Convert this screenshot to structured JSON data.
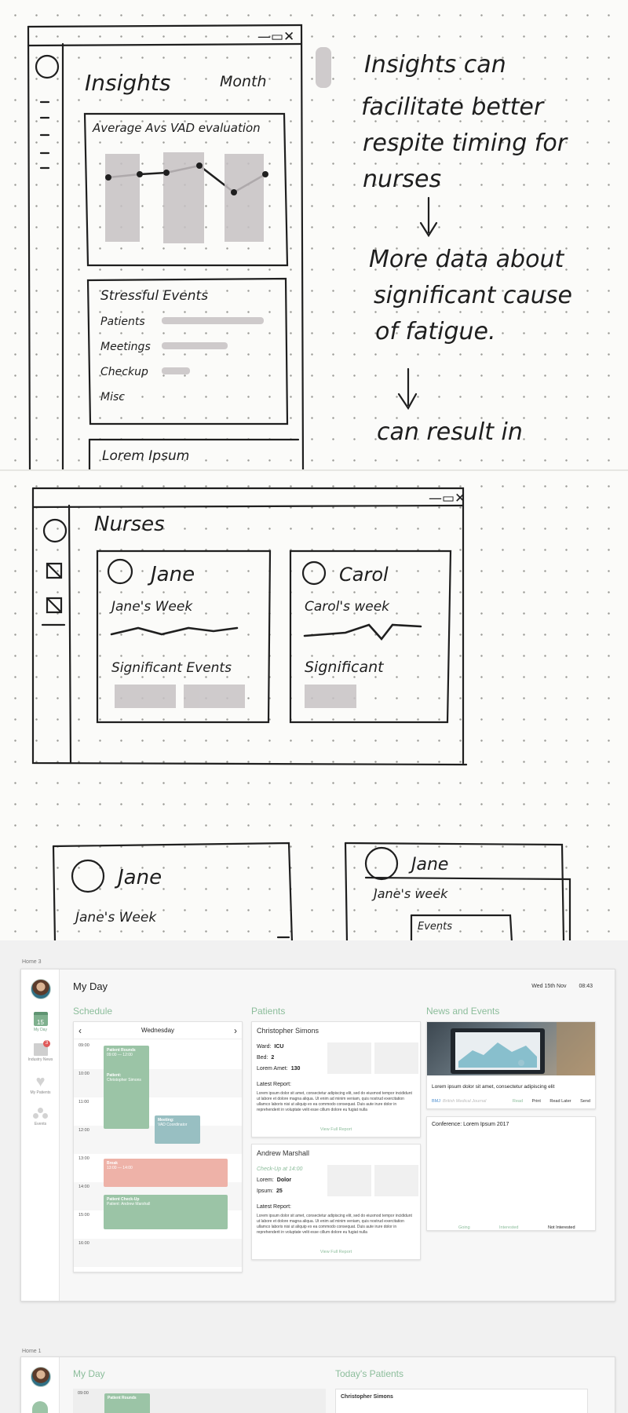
{
  "sketch1": {
    "window_controls": "—▭✕",
    "title": "Insights",
    "period_select": "Month",
    "chart_title": "Average Avs VAD evaluation",
    "events_title": "Stressful Events",
    "event_rows": [
      "Patients",
      "Meetings",
      "Checkup",
      "Misc"
    ],
    "bottom_card": "Lorem Ipsum",
    "note_lines": [
      "Insights can",
      "facilitate better",
      "respite timing for",
      "nurses",
      "↓",
      "More data about",
      "significant cause",
      "of fatigue.",
      "↓",
      "can result in"
    ]
  },
  "sketch2": {
    "title": "Nurses",
    "cards": [
      {
        "name": "Jane",
        "week": "Jane's Week",
        "events": "Significant Events"
      },
      {
        "name": "Carol",
        "week": "Carol's week",
        "events": "Significant"
      }
    ],
    "bottom_left": {
      "name": "Jane",
      "week": "Jane's Week"
    },
    "bottom_right": {
      "name": "Jane",
      "week": "Jane's week",
      "events": "Events"
    }
  },
  "home3": {
    "label": "Home 3",
    "page_title": "My Day",
    "date": "Wed 15th Nov",
    "time": "08:43",
    "nav": [
      {
        "label": "My Day",
        "icon": "calendar-icon",
        "day": "15"
      },
      {
        "label": "Industry News",
        "icon": "news-icon",
        "badge": "3"
      },
      {
        "label": "My Patients",
        "icon": "heart-icon"
      },
      {
        "label": "Events",
        "icon": "people-icon"
      }
    ],
    "schedule": {
      "title": "Schedule",
      "day": "Wednesday",
      "prev": "‹",
      "next": "›",
      "hours": [
        "09:00",
        "10:00",
        "11:00",
        "12:00",
        "13:00",
        "14:00",
        "15:00",
        "16:00"
      ],
      "events": [
        {
          "title": "Patient Rounds",
          "sub": "09:00 — 12:00",
          "color": "#9bc4a6"
        },
        {
          "title": "Patient:",
          "sub": "Christopher Simons",
          "color": "#9bc4a6"
        },
        {
          "title": "Meeting:",
          "sub": "VAD Coordinator",
          "color": "#98bfc2"
        },
        {
          "title": "Break",
          "sub": "13:00 — 14:00",
          "color": "#eeb2a8"
        },
        {
          "title": "Patient Check-Up",
          "sub": "Patient: Andrew Marshall",
          "color": "#9bc4a6"
        }
      ]
    },
    "patients": {
      "title": "Patients",
      "items": [
        {
          "name": "Christopher Simons",
          "f1_label": "Ward:",
          "f1_value": "ICU",
          "f2_label": "Bed:",
          "f2_value": "2",
          "f3_label": "Lorem Amet:",
          "f3_value": "130",
          "report_label": "Latest Report:",
          "report": "Lorem ipsum dolor sit amet, consectetur adipiscing elit, sed do eiusmod tempor incididunt ut labore et dolore magna aliqua. Ut enim ad minim veniam, quis nostrud exercitation ullamco laboris nisi ut aliquip ex ea commodo consequat. Duis aute irure dolor in reprehenderit in voluptate velit esse cillum dolore eu fugiat nulla",
          "link": "View Full Report"
        },
        {
          "name": "Andrew Marshall",
          "checkup": "Check-Up at 14:00",
          "f2_label": "Lorem:",
          "f2_value": "Dolor",
          "f3_label": "Ipsum:",
          "f3_value": "25",
          "report_label": "Latest Report:",
          "report": "Lorem ipsum dolor sit amet, consectetur adipiscing elit, sed do eiusmod tempor incididunt ut labore et dolore magna aliqua. Ut enim ad minim veniam, quis nostrud exercitation ullamco laboris nisi ut aliquip ex ea commodo consequat. Duis aute irure dolor in reprehenderit in voluptate velit esse cillum dolore eu fugiat nulla",
          "link": "View Full Report"
        }
      ]
    },
    "news": {
      "title": "News and Events",
      "article": {
        "headline": "Lorem ipsum dolor sit amet, consectetur adipiscing elit",
        "source": "BMJ",
        "source_full": "British Medical Journal",
        "actions": [
          "Read",
          "Print",
          "Read Later",
          "Send"
        ]
      },
      "event": {
        "title": "Conference: Lorem Ipsum 2017",
        "actions": [
          "Going",
          "Interested",
          "Not Interested"
        ]
      }
    }
  },
  "home1": {
    "label": "Home 1",
    "page_title": "My Day",
    "patients_title": "Today's Patients",
    "first_hour": "09:00",
    "first_event": "Patient Rounds",
    "first_patient": "Christopher Simons"
  },
  "colors": {
    "accent": "#8cbd9b",
    "event_green": "#9bc4a6",
    "event_blue": "#98bfc2",
    "event_red": "#eeb2a8",
    "badge": "#e05a5a"
  }
}
